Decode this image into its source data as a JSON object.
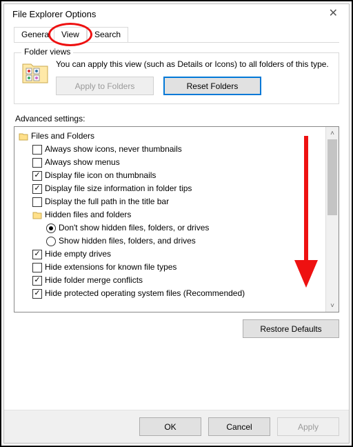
{
  "window": {
    "title": "File Explorer Options"
  },
  "tabs": {
    "general": "General",
    "view": "View",
    "search": "Search"
  },
  "folder_views": {
    "legend": "Folder views",
    "text": "You can apply this view (such as Details or Icons) to all folders of this type.",
    "apply_label": "Apply to Folders",
    "reset_label": "Reset Folders"
  },
  "advanced": {
    "label": "Advanced settings:",
    "root": "Files and Folders",
    "items": [
      {
        "checked": false,
        "text": "Always show icons, never thumbnails"
      },
      {
        "checked": false,
        "text": "Always show menus"
      },
      {
        "checked": true,
        "text": "Display file icon on thumbnails"
      },
      {
        "checked": true,
        "text": "Display file size information in folder tips"
      },
      {
        "checked": false,
        "text": "Display the full path in the title bar"
      }
    ],
    "hidden_group": "Hidden files and folders",
    "hidden_options": [
      {
        "selected": true,
        "text": "Don't show hidden files, folders, or drives"
      },
      {
        "selected": false,
        "text": "Show hidden files, folders, and drives"
      }
    ],
    "items2": [
      {
        "checked": true,
        "text": "Hide empty drives"
      },
      {
        "checked": false,
        "text": "Hide extensions for known file types"
      },
      {
        "checked": true,
        "text": "Hide folder merge conflicts"
      },
      {
        "checked": true,
        "text": "Hide protected operating system files (Recommended)"
      }
    ],
    "restore_label": "Restore Defaults"
  },
  "footer": {
    "ok": "OK",
    "cancel": "Cancel",
    "apply": "Apply"
  }
}
